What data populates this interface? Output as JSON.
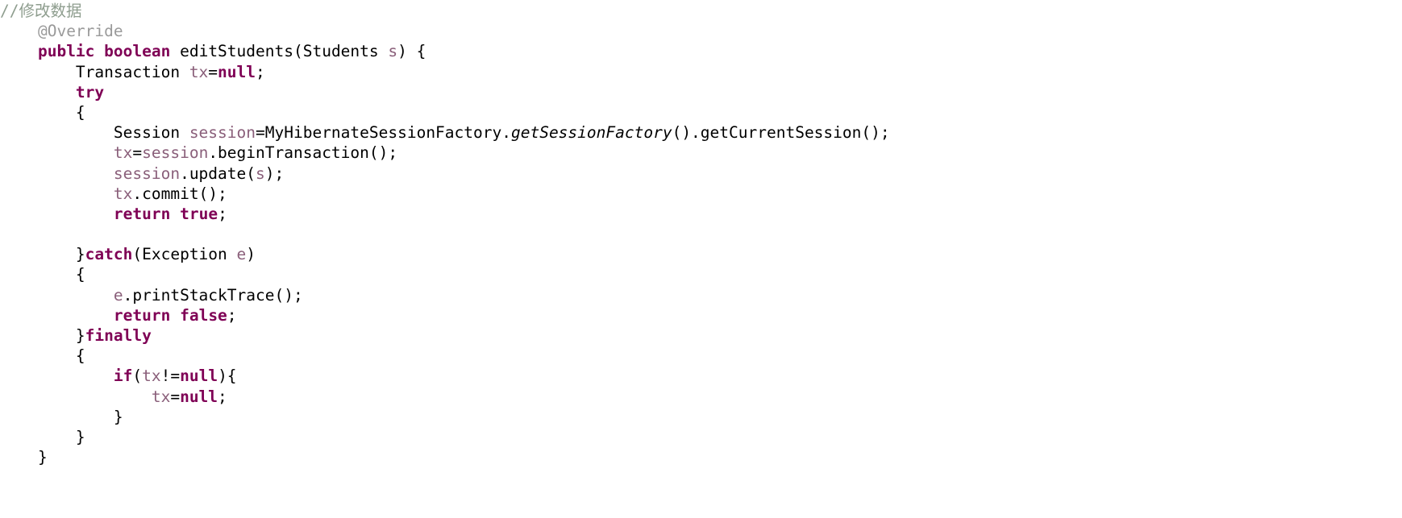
{
  "editor": {
    "language": "java",
    "background": "#ffffff",
    "colors": {
      "plain": "#000000",
      "keyword": "#7f0055",
      "comment": "#8f9e8f",
      "annotation": "#9a9a9a",
      "local_variable": "#8a5f7a",
      "static_method": "#000000"
    },
    "lines": [
      {
        "indent": 0,
        "tokens": [
          {
            "text": "//修改数据",
            "kind": "comment"
          }
        ]
      },
      {
        "indent": 1,
        "tokens": [
          {
            "text": "@Override",
            "kind": "annotation"
          }
        ]
      },
      {
        "indent": 1,
        "tokens": [
          {
            "text": "public",
            "kind": "keyword"
          },
          {
            "text": " ",
            "kind": "plain"
          },
          {
            "text": "boolean",
            "kind": "keyword"
          },
          {
            "text": " editStudents(Students ",
            "kind": "plain"
          },
          {
            "text": "s",
            "kind": "local_variable"
          },
          {
            "text": ") {",
            "kind": "plain"
          }
        ]
      },
      {
        "indent": 2,
        "tokens": [
          {
            "text": "Transaction ",
            "kind": "plain"
          },
          {
            "text": "tx",
            "kind": "local_variable"
          },
          {
            "text": "=",
            "kind": "plain"
          },
          {
            "text": "null",
            "kind": "keyword"
          },
          {
            "text": ";",
            "kind": "plain"
          }
        ]
      },
      {
        "indent": 2,
        "tokens": [
          {
            "text": "try",
            "kind": "keyword"
          }
        ]
      },
      {
        "indent": 2,
        "tokens": [
          {
            "text": "{",
            "kind": "plain"
          }
        ]
      },
      {
        "indent": 3,
        "tokens": [
          {
            "text": "Session ",
            "kind": "plain"
          },
          {
            "text": "session",
            "kind": "local_variable"
          },
          {
            "text": "=MyHibernateSessionFactory.",
            "kind": "plain"
          },
          {
            "text": "getSessionFactory",
            "kind": "static_method"
          },
          {
            "text": "().getCurrentSession();",
            "kind": "plain"
          }
        ]
      },
      {
        "indent": 3,
        "tokens": [
          {
            "text": "tx",
            "kind": "local_variable"
          },
          {
            "text": "=",
            "kind": "plain"
          },
          {
            "text": "session",
            "kind": "local_variable"
          },
          {
            "text": ".beginTransaction();",
            "kind": "plain"
          }
        ]
      },
      {
        "indent": 3,
        "tokens": [
          {
            "text": "session",
            "kind": "local_variable"
          },
          {
            "text": ".update(",
            "kind": "plain"
          },
          {
            "text": "s",
            "kind": "local_variable"
          },
          {
            "text": ");",
            "kind": "plain"
          }
        ]
      },
      {
        "indent": 3,
        "tokens": [
          {
            "text": "tx",
            "kind": "local_variable"
          },
          {
            "text": ".commit();",
            "kind": "plain"
          }
        ]
      },
      {
        "indent": 3,
        "tokens": [
          {
            "text": "return",
            "kind": "keyword"
          },
          {
            "text": " ",
            "kind": "plain"
          },
          {
            "text": "true",
            "kind": "keyword"
          },
          {
            "text": ";",
            "kind": "plain"
          }
        ]
      },
      {
        "indent": 0,
        "tokens": []
      },
      {
        "indent": 2,
        "tokens": [
          {
            "text": "}",
            "kind": "plain"
          },
          {
            "text": "catch",
            "kind": "keyword"
          },
          {
            "text": "(Exception ",
            "kind": "plain"
          },
          {
            "text": "e",
            "kind": "local_variable"
          },
          {
            "text": ")",
            "kind": "plain"
          }
        ]
      },
      {
        "indent": 2,
        "tokens": [
          {
            "text": "{",
            "kind": "plain"
          }
        ]
      },
      {
        "indent": 3,
        "tokens": [
          {
            "text": "e",
            "kind": "local_variable"
          },
          {
            "text": ".printStackTrace();",
            "kind": "plain"
          }
        ]
      },
      {
        "indent": 3,
        "tokens": [
          {
            "text": "return",
            "kind": "keyword"
          },
          {
            "text": " ",
            "kind": "plain"
          },
          {
            "text": "false",
            "kind": "keyword"
          },
          {
            "text": ";",
            "kind": "plain"
          }
        ]
      },
      {
        "indent": 2,
        "tokens": [
          {
            "text": "}",
            "kind": "plain"
          },
          {
            "text": "finally",
            "kind": "keyword"
          }
        ]
      },
      {
        "indent": 2,
        "tokens": [
          {
            "text": "{",
            "kind": "plain"
          }
        ]
      },
      {
        "indent": 3,
        "tokens": [
          {
            "text": "if",
            "kind": "keyword"
          },
          {
            "text": "(",
            "kind": "plain"
          },
          {
            "text": "tx",
            "kind": "local_variable"
          },
          {
            "text": "!=",
            "kind": "plain"
          },
          {
            "text": "null",
            "kind": "keyword"
          },
          {
            "text": "){",
            "kind": "plain"
          }
        ]
      },
      {
        "indent": 4,
        "tokens": [
          {
            "text": "tx",
            "kind": "local_variable"
          },
          {
            "text": "=",
            "kind": "plain"
          },
          {
            "text": "null",
            "kind": "keyword"
          },
          {
            "text": ";",
            "kind": "plain"
          }
        ]
      },
      {
        "indent": 3,
        "tokens": [
          {
            "text": "}",
            "kind": "plain"
          }
        ]
      },
      {
        "indent": 2,
        "tokens": [
          {
            "text": "}",
            "kind": "plain"
          }
        ]
      },
      {
        "indent": 1,
        "tokens": [
          {
            "text": "}",
            "kind": "plain"
          }
        ]
      }
    ]
  }
}
